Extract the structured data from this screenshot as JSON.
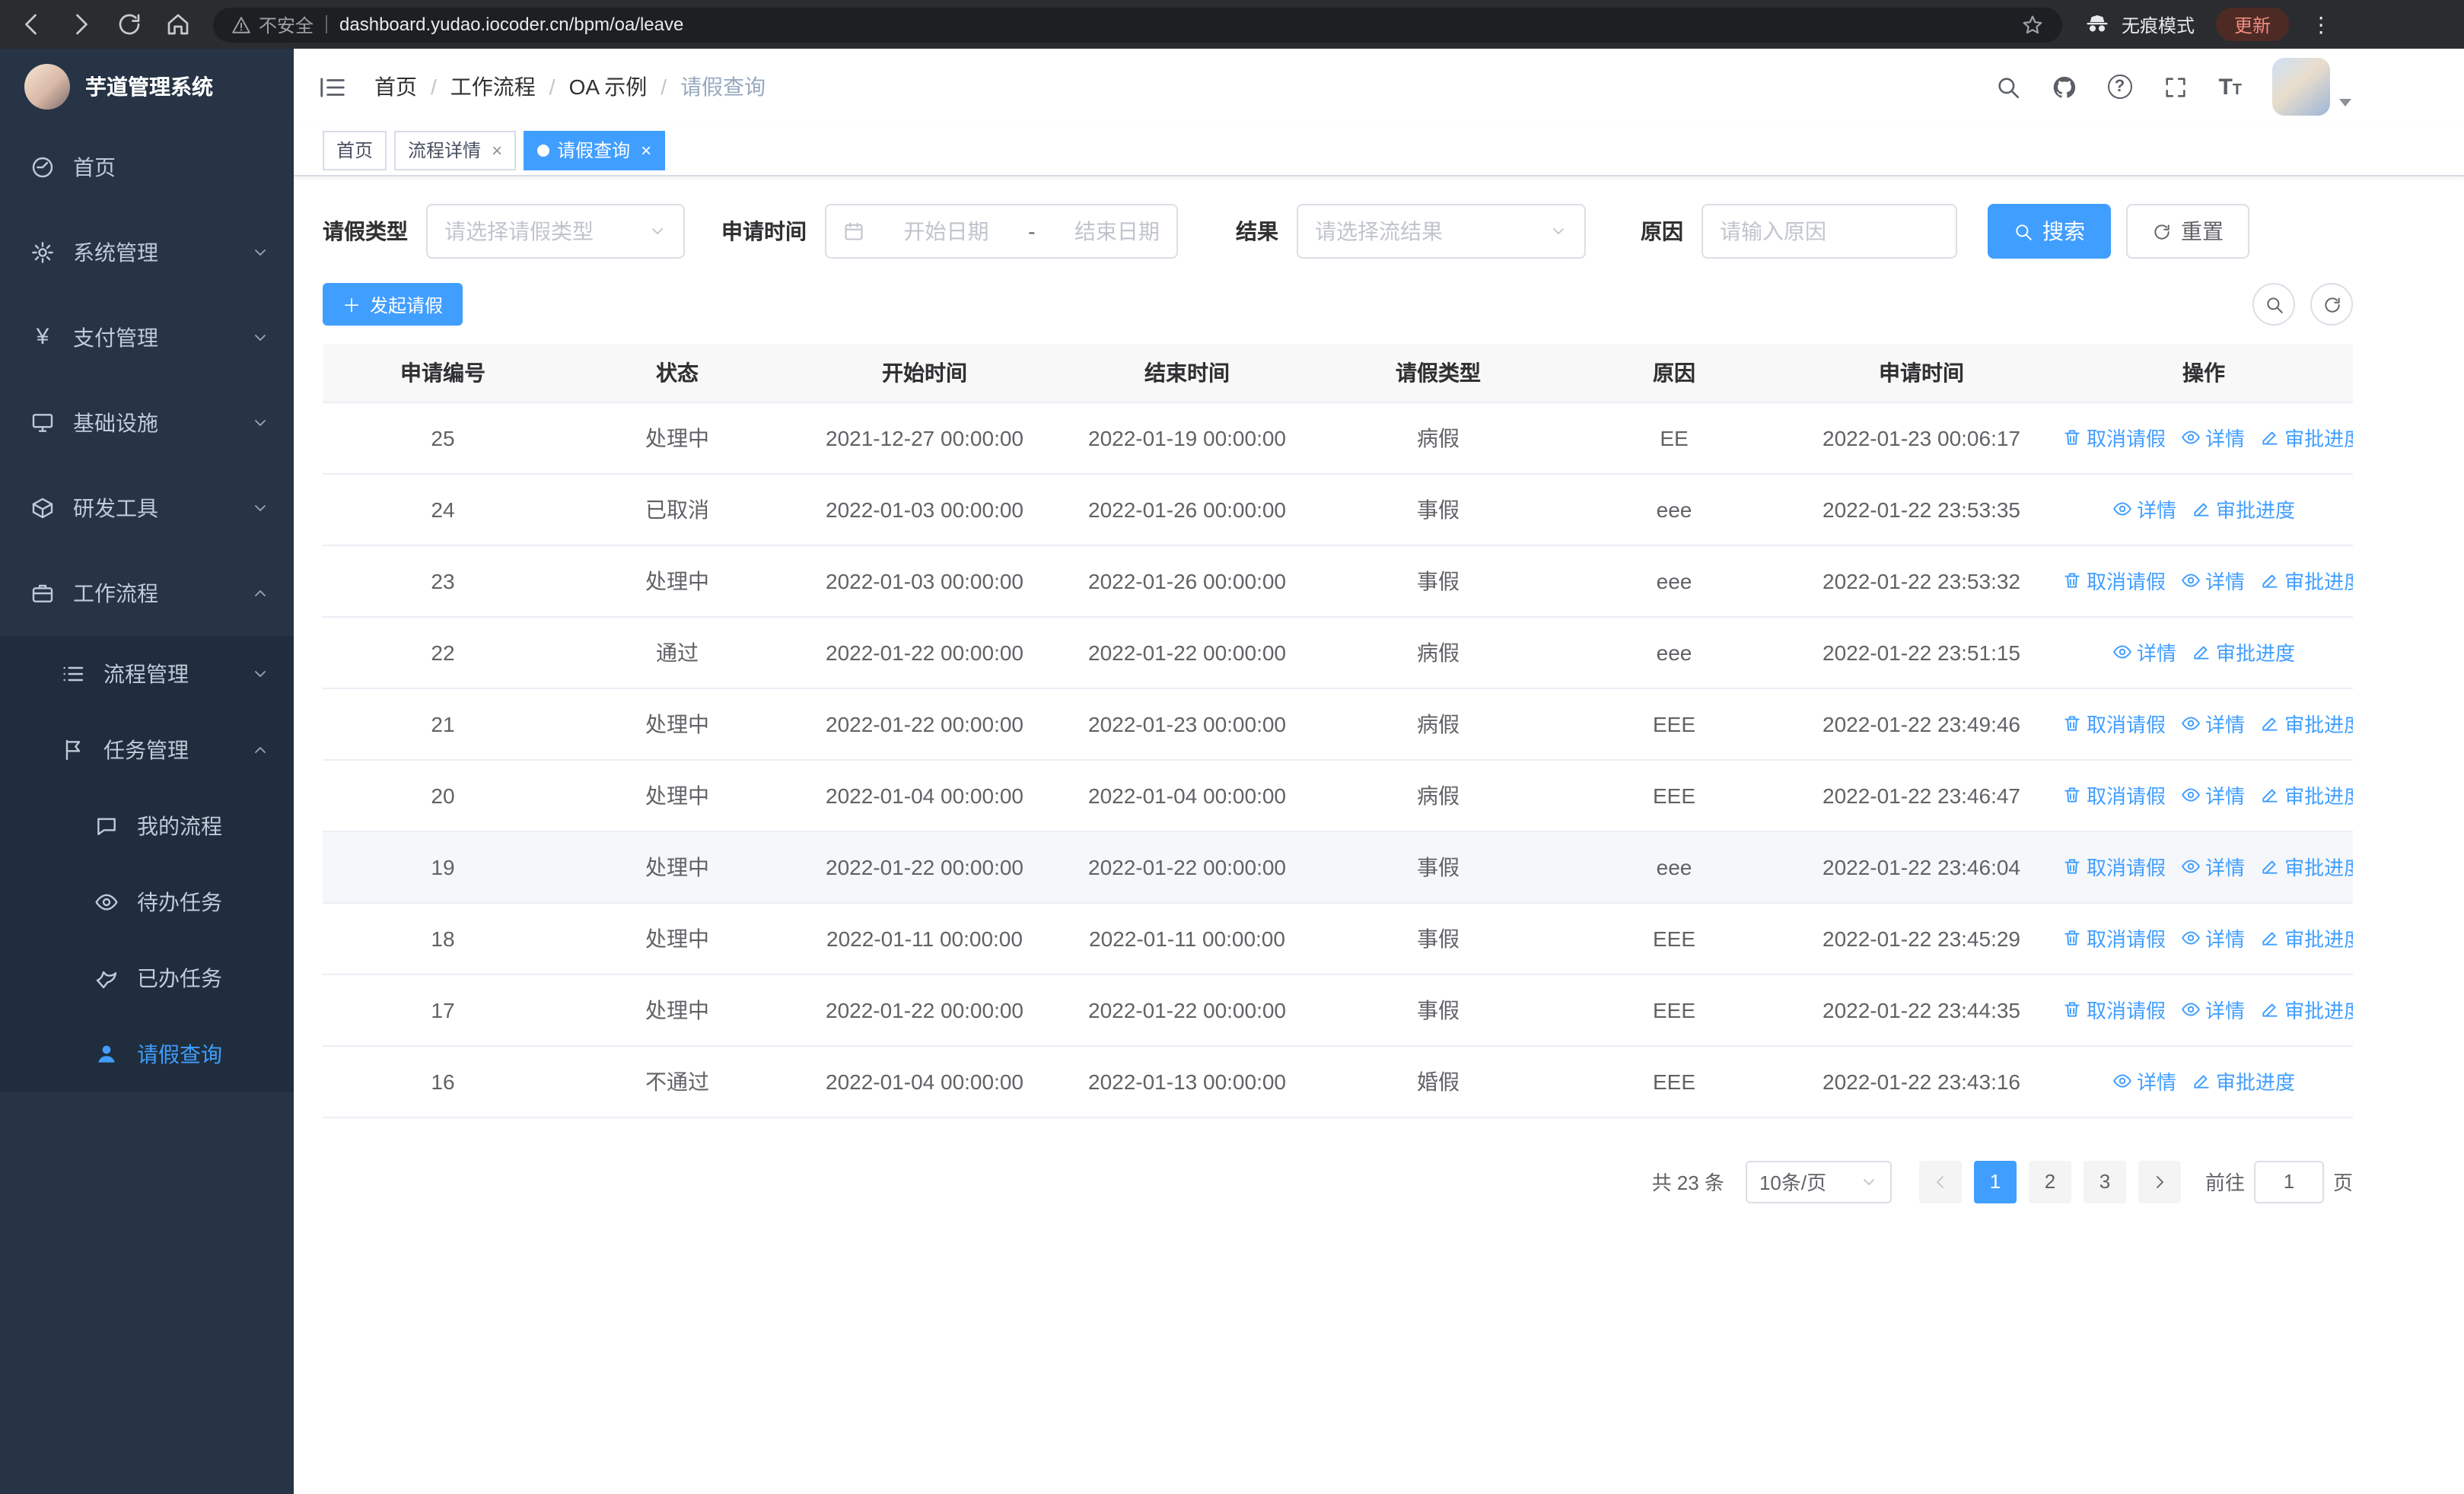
{
  "theme": {
    "primary": "#409EFF",
    "sidebar_bg": "#263445",
    "submenu_bg": "#1f2d3d"
  },
  "browser": {
    "security_warning": "不安全",
    "url": "dashboard.yudao.iocoder.cn/bpm/oa/leave",
    "incognito_label": "无痕模式",
    "update_label": "更新"
  },
  "sidebar": {
    "logo_title": "芋道管理系统",
    "menu": [
      {
        "label": "首页"
      },
      {
        "label": "系统管理"
      },
      {
        "label": "支付管理"
      },
      {
        "label": "基础设施"
      },
      {
        "label": "研发工具"
      },
      {
        "label": "工作流程"
      },
      {
        "label": "流程管理"
      },
      {
        "label": "任务管理"
      },
      {
        "label": "我的流程"
      },
      {
        "label": "待办任务"
      },
      {
        "label": "已办任务"
      },
      {
        "label": "请假查询"
      }
    ]
  },
  "navbar": {
    "breadcrumb": [
      "首页",
      "工作流程",
      "OA 示例",
      "请假查询"
    ],
    "separator": "/"
  },
  "tabs": [
    {
      "label": "首页",
      "closable": false,
      "active": false
    },
    {
      "label": "流程详情",
      "closable": true,
      "active": false
    },
    {
      "label": "请假查询",
      "closable": true,
      "active": true
    }
  ],
  "filters": {
    "leave_type_label": "请假类型",
    "leave_type_placeholder": "请选择请假类型",
    "apply_time_label": "申请时间",
    "start_date_placeholder": "开始日期",
    "range_separator": "-",
    "end_date_placeholder": "结束日期",
    "result_label": "结果",
    "result_placeholder": "请选择流结果",
    "reason_label": "原因",
    "reason_placeholder": "请输入原因",
    "search_label": "搜索",
    "reset_label": "重置"
  },
  "toolbar": {
    "create_label": "发起请假"
  },
  "table": {
    "columns": [
      "申请编号",
      "状态",
      "开始时间",
      "结束时间",
      "请假类型",
      "原因",
      "申请时间",
      "操作"
    ],
    "actions": {
      "cancel": "取消请假",
      "detail": "详情",
      "progress": "审批进度"
    },
    "rows": [
      {
        "id": "25",
        "status": "处理中",
        "start": "2021-12-27 00:00:00",
        "end": "2022-01-19 00:00:00",
        "type": "病假",
        "reason": "EE",
        "apply_time": "2022-01-23 00:06:17",
        "cancellable": true,
        "highlight": false
      },
      {
        "id": "24",
        "status": "已取消",
        "start": "2022-01-03 00:00:00",
        "end": "2022-01-26 00:00:00",
        "type": "事假",
        "reason": "eee",
        "apply_time": "2022-01-22 23:53:35",
        "cancellable": false,
        "highlight": false
      },
      {
        "id": "23",
        "status": "处理中",
        "start": "2022-01-03 00:00:00",
        "end": "2022-01-26 00:00:00",
        "type": "事假",
        "reason": "eee",
        "apply_time": "2022-01-22 23:53:32",
        "cancellable": true,
        "highlight": false
      },
      {
        "id": "22",
        "status": "通过",
        "start": "2022-01-22 00:00:00",
        "end": "2022-01-22 00:00:00",
        "type": "病假",
        "reason": "eee",
        "apply_time": "2022-01-22 23:51:15",
        "cancellable": false,
        "highlight": false
      },
      {
        "id": "21",
        "status": "处理中",
        "start": "2022-01-22 00:00:00",
        "end": "2022-01-23 00:00:00",
        "type": "病假",
        "reason": "EEE",
        "apply_time": "2022-01-22 23:49:46",
        "cancellable": true,
        "highlight": false
      },
      {
        "id": "20",
        "status": "处理中",
        "start": "2022-01-04 00:00:00",
        "end": "2022-01-04 00:00:00",
        "type": "病假",
        "reason": "EEE",
        "apply_time": "2022-01-22 23:46:47",
        "cancellable": true,
        "highlight": false
      },
      {
        "id": "19",
        "status": "处理中",
        "start": "2022-01-22 00:00:00",
        "end": "2022-01-22 00:00:00",
        "type": "事假",
        "reason": "eee",
        "apply_time": "2022-01-22 23:46:04",
        "cancellable": true,
        "highlight": true
      },
      {
        "id": "18",
        "status": "处理中",
        "start": "2022-01-11 00:00:00",
        "end": "2022-01-11 00:00:00",
        "type": "事假",
        "reason": "EEE",
        "apply_time": "2022-01-22 23:45:29",
        "cancellable": true,
        "highlight": false
      },
      {
        "id": "17",
        "status": "处理中",
        "start": "2022-01-22 00:00:00",
        "end": "2022-01-22 00:00:00",
        "type": "事假",
        "reason": "EEE",
        "apply_time": "2022-01-22 23:44:35",
        "cancellable": true,
        "highlight": false
      },
      {
        "id": "16",
        "status": "不通过",
        "start": "2022-01-04 00:00:00",
        "end": "2022-01-13 00:00:00",
        "type": "婚假",
        "reason": "EEE",
        "apply_time": "2022-01-22 23:43:16",
        "cancellable": false,
        "highlight": false
      }
    ]
  },
  "pagination": {
    "total_text": "共 23 条",
    "page_size": "10条/页",
    "pages": [
      "1",
      "2",
      "3"
    ],
    "current_page": "1",
    "goto_label": "前往",
    "goto_value": "1",
    "page_suffix": "页"
  }
}
